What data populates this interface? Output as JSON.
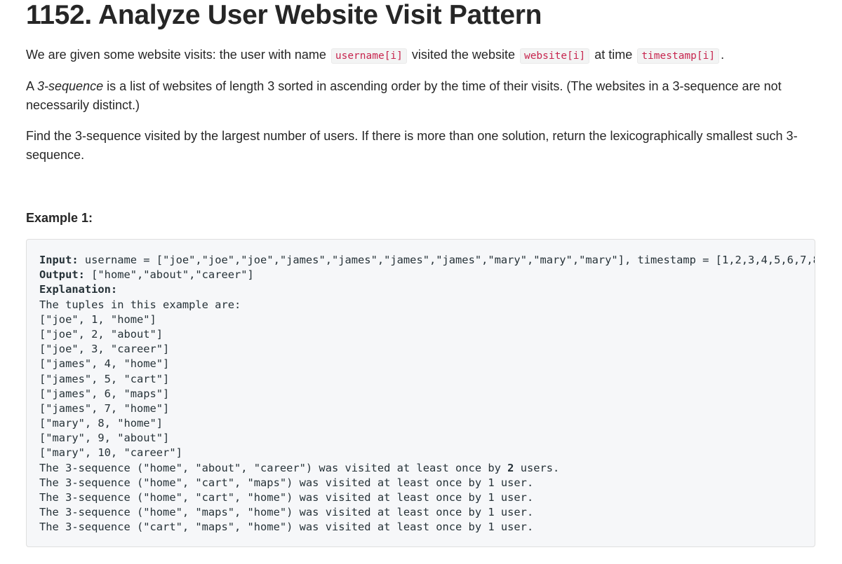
{
  "title": "1152. Analyze User Website Visit Pattern",
  "paragraph1": {
    "text_a": "We are given some website visits: the user with name ",
    "code_a": "username[i]",
    "text_b": " visited the website ",
    "code_b": "website[i]",
    "text_c": " at time ",
    "code_c": "timestamp[i]",
    "text_d": "."
  },
  "paragraph2": {
    "text_a": "A ",
    "em": "3-sequence",
    "text_b": " is a list of websites of length 3 sorted in ascending order by the time of their visits.  (The websites in a 3-sequence are not necessarily distinct.)"
  },
  "paragraph3": "Find the 3-sequence visited by the largest number of users. If there is more than one solution, return the lexicographically smallest such 3-sequence.",
  "example_heading": "Example 1:",
  "example": {
    "input_label": "Input:",
    "input_value": " username = [\"joe\",\"joe\",\"joe\",\"james\",\"james\",\"james\",\"james\",\"mary\",\"mary\",\"mary\"], timestamp = [1,2,3,4,5,6,7,8,",
    "output_label": "Output:",
    "output_value": " [\"home\",\"about\",\"career\"]",
    "explanation_label": "Explanation:",
    "tuples_intro": "The tuples in this example are:",
    "tuples": [
      "[\"joe\", 1, \"home\"]",
      "[\"joe\", 2, \"about\"]",
      "[\"joe\", 3, \"career\"]",
      "[\"james\", 4, \"home\"]",
      "[\"james\", 5, \"cart\"]",
      "[\"james\", 6, \"maps\"]",
      "[\"james\", 7, \"home\"]",
      "[\"mary\", 8, \"home\"]",
      "[\"mary\", 9, \"about\"]",
      "[\"mary\", 10, \"career\"]"
    ],
    "seq1_before": "The 3-sequence (\"home\", \"about\", \"career\") was visited at least once by ",
    "seq1_bold": "2",
    "seq1_after": " users.",
    "sequences": [
      "The 3-sequence (\"home\", \"cart\", \"maps\") was visited at least once by 1 user.",
      "The 3-sequence (\"home\", \"cart\", \"home\") was visited at least once by 1 user.",
      "The 3-sequence (\"home\", \"maps\", \"home\") was visited at least once by 1 user.",
      "The 3-sequence (\"cart\", \"maps\", \"home\") was visited at least once by 1 user."
    ]
  }
}
